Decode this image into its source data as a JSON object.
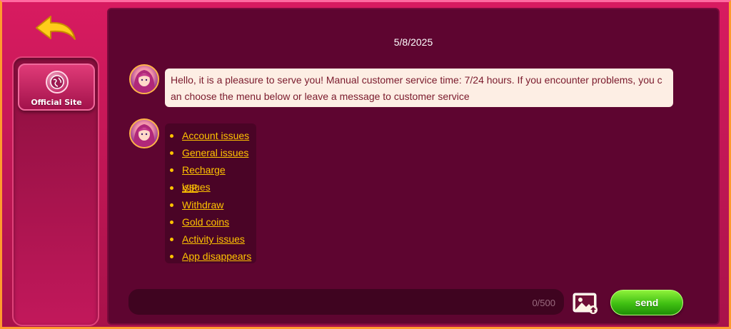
{
  "header": {
    "back_icon": "back-arrow-icon"
  },
  "sidebar": {
    "items": [
      {
        "label": "Official Site",
        "icon": "globe-icon"
      }
    ]
  },
  "chat": {
    "date": "5/8/2025",
    "welcome_message": "Hello, it is a pleasure to serve you! Manual customer service time: 7/24 hours. If you encounter problems, you can choose the menu below or leave a message to customer service",
    "menu": [
      "Account issues",
      "General issues",
      "Recharge issues",
      "VIP",
      "Withdraw",
      "Gold coins",
      "Activity issues",
      "App disappears"
    ]
  },
  "composer": {
    "input_value": "",
    "counter": "0/500",
    "upload_icon": "image-upload-icon",
    "send_label": "send"
  },
  "colors": {
    "accent": "#ffc400",
    "panel": "#5e0530",
    "send": "#3fbf12"
  }
}
